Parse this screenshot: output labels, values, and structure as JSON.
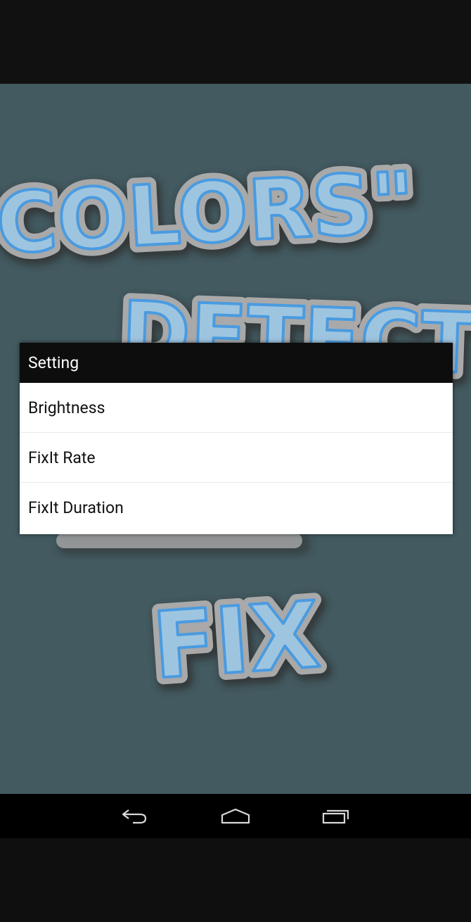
{
  "background_art": {
    "line1": "\"COLORS\"",
    "line2": "DETECT",
    "line3": "FIX",
    "text_color": "#4a9be0",
    "outline_color": "#a9a9a9"
  },
  "dialog": {
    "title": "Setting",
    "options": [
      {
        "label": "Brightness"
      },
      {
        "label": "FixIt Rate"
      },
      {
        "label": "FixIt Duration"
      }
    ]
  },
  "nav_bar": {
    "icons": [
      "back-icon",
      "home-icon",
      "recent-apps-icon"
    ]
  }
}
